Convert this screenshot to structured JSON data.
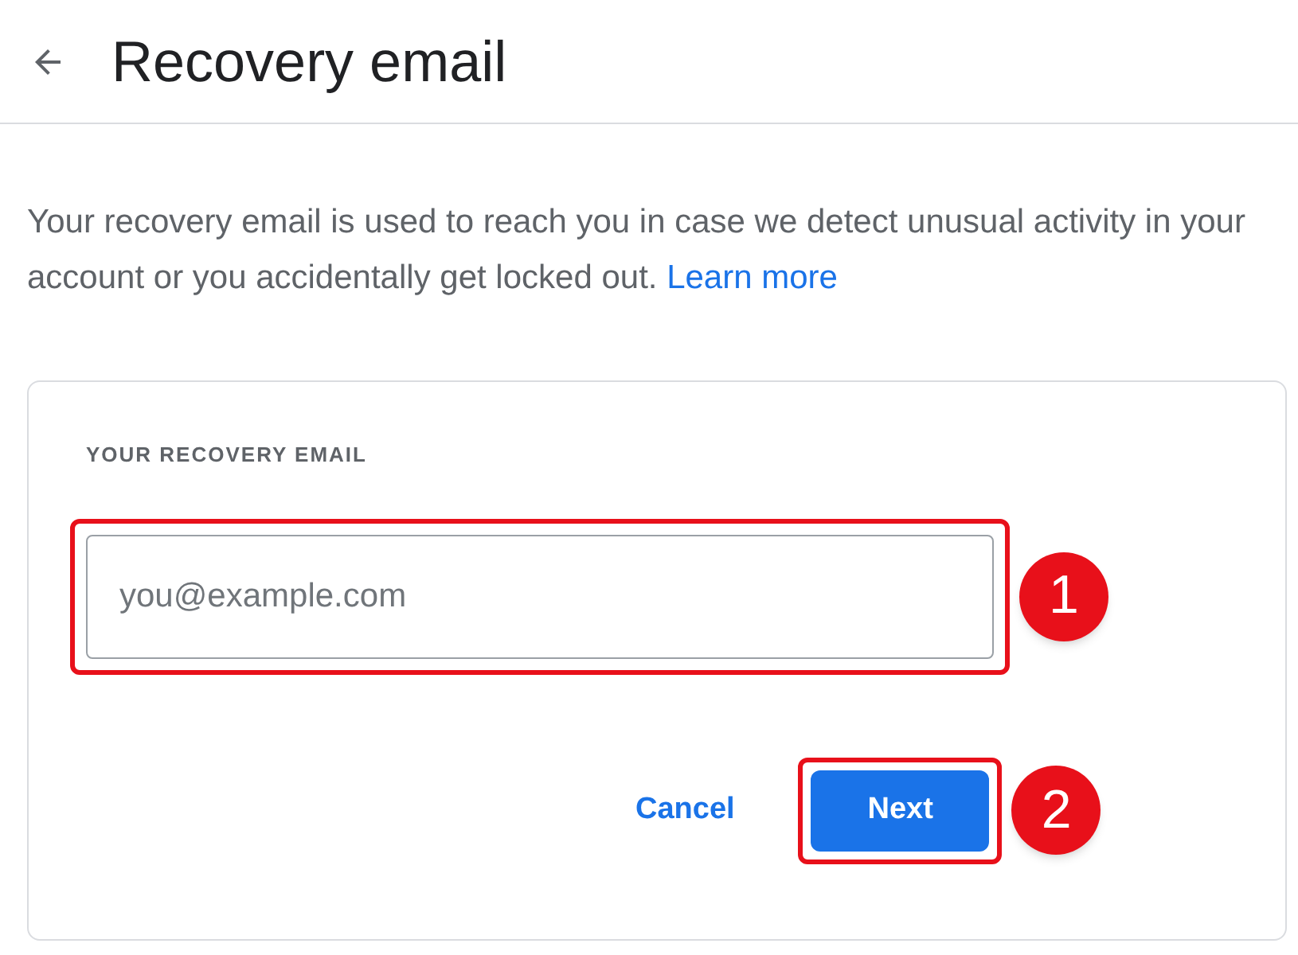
{
  "header": {
    "title": "Recovery email"
  },
  "description": {
    "text": "Your recovery email is used to reach you in case we detect unusual activity in your account or you accidentally get locked out.",
    "link": "Learn more"
  },
  "form": {
    "label": "YOUR RECOVERY EMAIL",
    "placeholder": "you@example.com",
    "buttons": [
      "Cancel",
      "Next"
    ]
  },
  "annotations": [
    {
      "label": "1"
    },
    {
      "label": "2"
    }
  ]
}
